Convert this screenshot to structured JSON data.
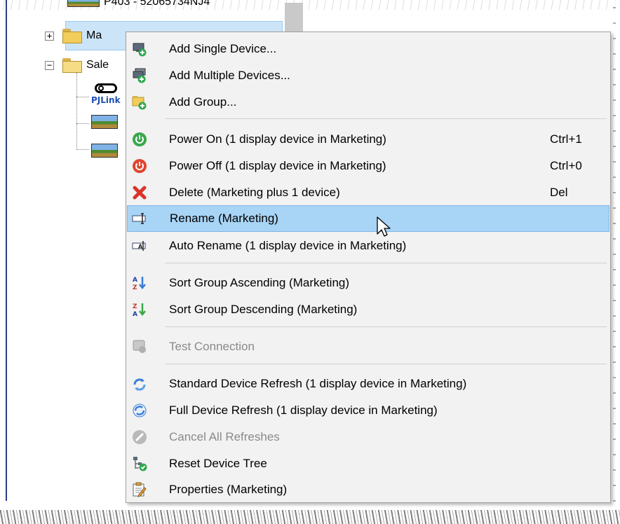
{
  "tree": {
    "top_partial_label": "P403 - 52065734NJ4",
    "marketing_label": "Ma",
    "sales_label": "Sale",
    "pjlink_label": "PJLink",
    "expand_glyph": "+",
    "collapse_glyph": "−"
  },
  "menu": {
    "items": [
      {
        "label": "Add Single Device...",
        "icon": "add-single-device-icon",
        "shortcut": ""
      },
      {
        "label": "Add Multiple Devices...",
        "icon": "add-multiple-devices-icon",
        "shortcut": ""
      },
      {
        "label": "Add Group...",
        "icon": "add-group-icon",
        "shortcut": ""
      },
      {
        "label": "Power On  (1 display device in Marketing)",
        "icon": "power-on-icon",
        "shortcut": "Ctrl+1"
      },
      {
        "label": "Power Off  (1 display device in Marketing)",
        "icon": "power-off-icon",
        "shortcut": "Ctrl+0"
      },
      {
        "label": "Delete  (Marketing plus 1 device)",
        "icon": "delete-icon",
        "shortcut": "Del"
      },
      {
        "label": "Rename  (Marketing)",
        "icon": "rename-icon",
        "shortcut": "",
        "highlighted": true
      },
      {
        "label": "Auto Rename  (1 display device in Marketing)",
        "icon": "auto-rename-icon",
        "shortcut": ""
      },
      {
        "label": "Sort Group Ascending  (Marketing)",
        "icon": "sort-ascending-icon",
        "shortcut": ""
      },
      {
        "label": "Sort Group Descending  (Marketing)",
        "icon": "sort-descending-icon",
        "shortcut": ""
      },
      {
        "label": "Test Connection",
        "icon": "test-connection-icon",
        "shortcut": "",
        "disabled": true
      },
      {
        "label": "Standard Device Refresh  (1 display device in Marketing)",
        "icon": "standard-refresh-icon",
        "shortcut": ""
      },
      {
        "label": "Full Device Refresh  (1 display device in Marketing)",
        "icon": "full-refresh-icon",
        "shortcut": ""
      },
      {
        "label": "Cancel All Refreshes",
        "icon": "cancel-refresh-icon",
        "shortcut": "",
        "disabled": true
      },
      {
        "label": "Reset Device Tree",
        "icon": "reset-tree-icon",
        "shortcut": ""
      },
      {
        "label": "Properties  (Marketing)",
        "icon": "properties-icon",
        "shortcut": ""
      }
    ]
  },
  "colors": {
    "menu_background": "#f2f2f2",
    "highlight": "#a8d4f5",
    "tree_selection": "#cce4f7",
    "disabled_text": "#8a8a8a",
    "power_on": "#3aa84a",
    "power_off": "#e0452f",
    "delete": "#d9342b"
  }
}
